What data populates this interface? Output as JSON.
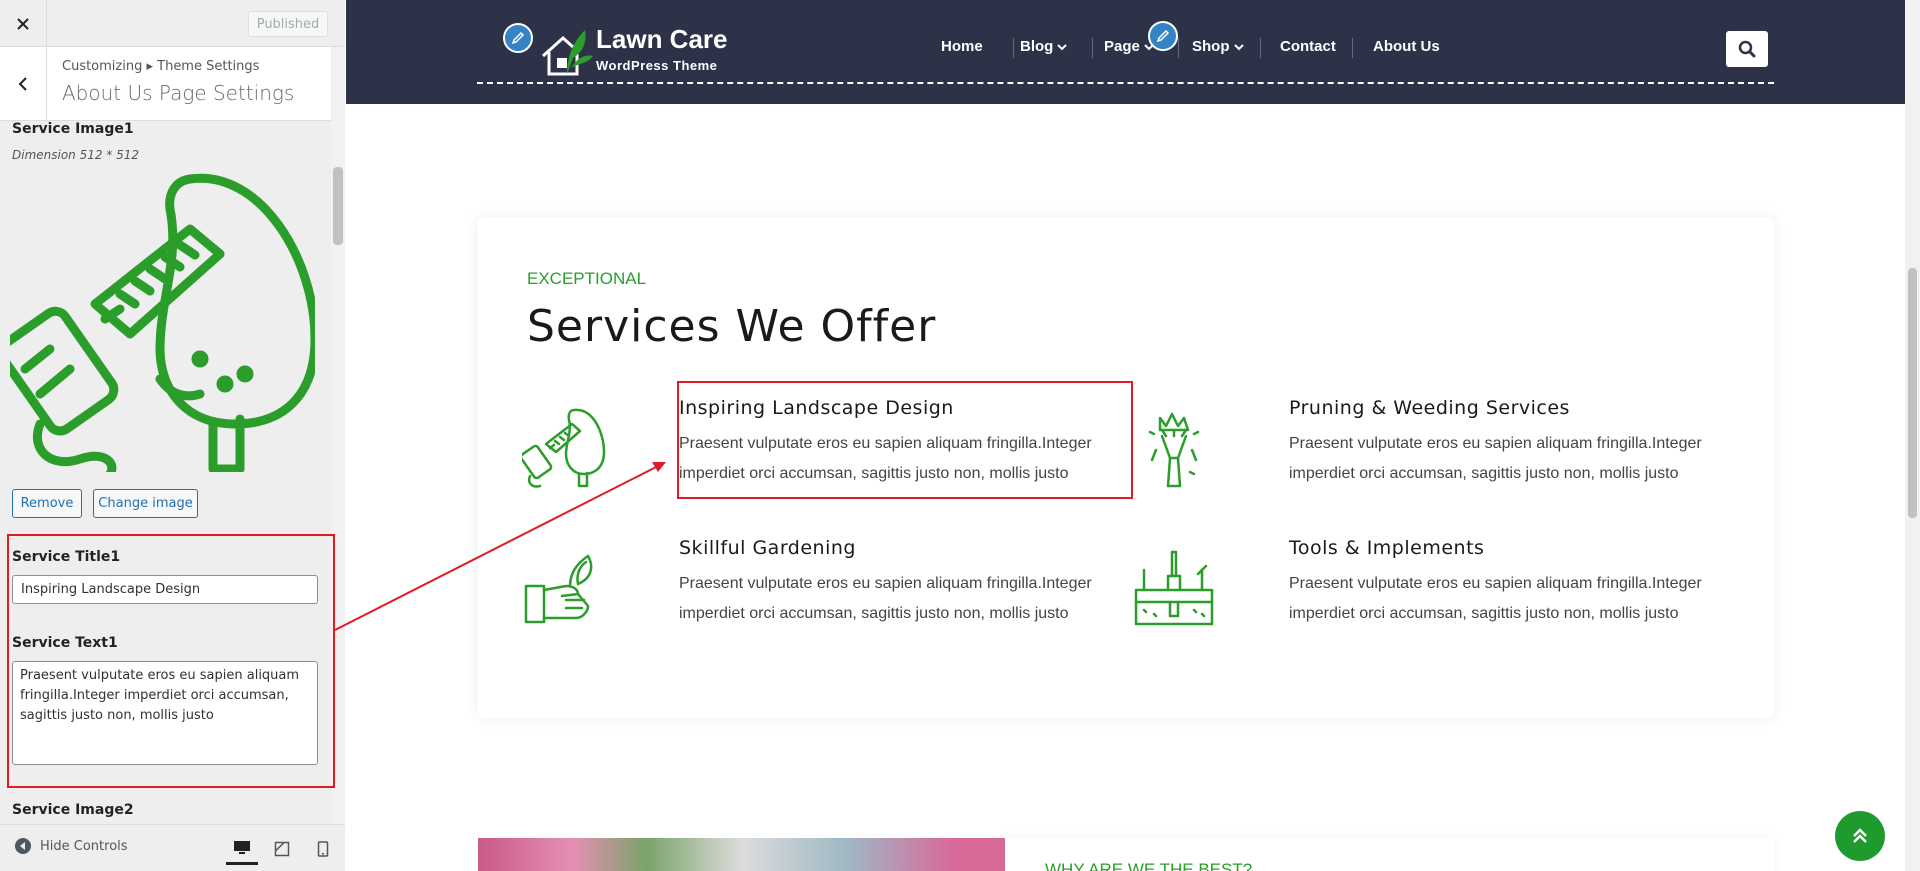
{
  "customizer": {
    "publish_label": "Published",
    "breadcrumb": "Customizing ▸ Theme Settings",
    "section_title": "About Us Page Settings",
    "image1_label": "Service Image1",
    "image1_dimension": "Dimension 512 * 512",
    "remove_label": "Remove",
    "change_image_label": "Change image",
    "title1_label": "Service Title1",
    "title1_value": "Inspiring Landscape Design",
    "text1_label": "Service Text1",
    "text1_value": "Praesent vulputate eros eu sapien aliquam fringilla.Integer imperdiet orci accumsan, sagittis justo non, mollis justo",
    "image2_label": "Service Image2",
    "hide_controls_label": "Hide Controls"
  },
  "site": {
    "logo_title": "Lawn Care",
    "logo_tagline": "WordPress Theme",
    "nav": [
      {
        "label": "Home"
      },
      {
        "label": "Blog"
      },
      {
        "label": "Page"
      },
      {
        "label": "Shop"
      },
      {
        "label": "Contact"
      },
      {
        "label": "About Us"
      }
    ]
  },
  "services": {
    "eyebrow": "EXCEPTIONAL",
    "title": "Services We Offer",
    "items": [
      {
        "title": "Inspiring Landscape Design",
        "text": "Praesent vulputate eros eu sapien aliquam fringilla.Integer imperdiet orci accumsan, sagittis justo non, mollis justo",
        "icon": "hedge-trimmer-icon"
      },
      {
        "title": "Pruning & Weeding Services",
        "text": "Praesent vulputate eros eu sapien aliquam fringilla.Integer imperdiet orci accumsan, sagittis justo non, mollis justo",
        "icon": "flower-bouquet-icon"
      },
      {
        "title": "Skillful Gardening",
        "text": "Praesent vulputate eros eu sapien aliquam fringilla.Integer imperdiet orci accumsan, sagittis justo non, mollis justo",
        "icon": "hand-sprout-icon"
      },
      {
        "title": "Tools & Implements",
        "text": "Praesent vulputate eros eu sapien aliquam fringilla.Integer imperdiet orci accumsan, sagittis justo non, mollis justo",
        "icon": "toolbox-icon"
      }
    ]
  },
  "why": {
    "eyebrow": "WHY ARE WE THE BEST?"
  },
  "colors": {
    "accent_green": "#2a9d2a",
    "header_navy": "#2e3248",
    "highlight_red": "#e01b24",
    "wp_blue": "#2271b1"
  }
}
